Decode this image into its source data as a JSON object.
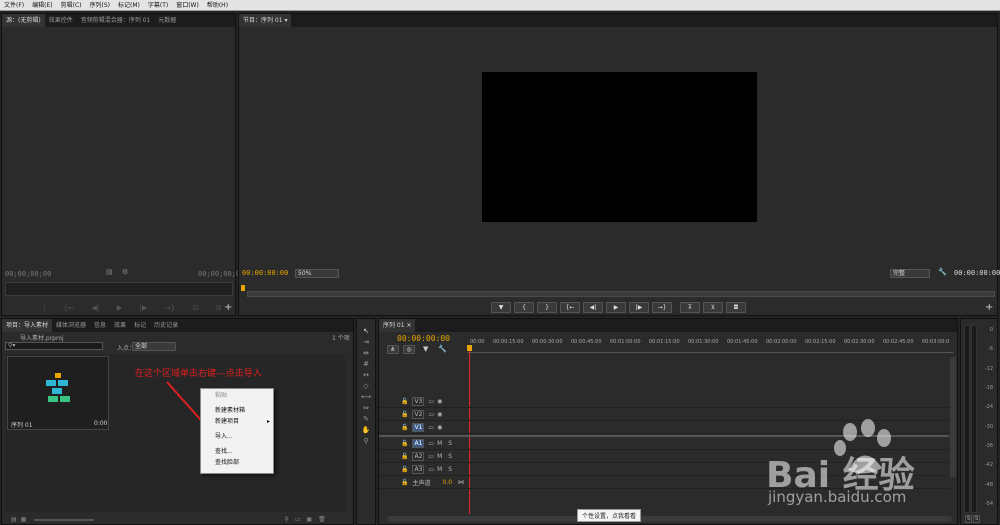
{
  "menu": [
    "文件(F)",
    "编辑(E)",
    "剪辑(C)",
    "序列(S)",
    "标记(M)",
    "字幕(T)",
    "窗口(W)",
    "帮助(H)"
  ],
  "source_panel": {
    "tabs": [
      "源：(无剪辑)",
      "效果控件",
      "音频剪辑混合器：序列 01",
      "元数据"
    ],
    "timecode_left": "00;00;00;00",
    "timecode_right": "00;00;00;00"
  },
  "program_panel": {
    "tab": "节目：序列 01",
    "timecode": "00:00:00:00",
    "zoom": "50%",
    "quality": "完整",
    "timecode_right": "00:00:00:00"
  },
  "project_panel": {
    "tabs": [
      "项目：导入素材",
      "媒体浏览器",
      "信息",
      "效果",
      "标记",
      "历史记录"
    ],
    "project_file": "导入素材.prproj",
    "item_count": "1 个项",
    "inpoint_label": "入点：",
    "inpoint_value": "全部",
    "clip_name": "序列 01",
    "clip_duration": "0:00",
    "annotation": "在这个区域单击右键---点击导入"
  },
  "context_menu": {
    "items": [
      "粘贴",
      "新建素材箱",
      "新建项目",
      "导入...",
      "查找...",
      "查找脸部"
    ]
  },
  "timeline": {
    "tab": "序列 01",
    "timecode": "00:00:00:00",
    "ruler": [
      "00:00",
      "00:00:15:00",
      "00:00:30:00",
      "00:00:45:00",
      "00:01:00:00",
      "00:01:15:00",
      "00:01:30:00",
      "00:01:45:00",
      "00:02:00:00",
      "00:02:15:00",
      "00:02:30:00",
      "00:02:45:00",
      "00:03:00:0"
    ],
    "video_tracks": [
      "V3",
      "V2",
      "V1"
    ],
    "audio_tracks": [
      "A1",
      "A2",
      "A3"
    ],
    "master": "主声道",
    "master_value": "0.0",
    "m_label": "M",
    "s_label": "S"
  },
  "tooltip": "个性设置，点我看看",
  "meter": {
    "ticks": [
      "0",
      "-6",
      "-12",
      "-18",
      "-24",
      "-30",
      "-36",
      "-42",
      "-48",
      "-54"
    ],
    "buttons": [
      "S",
      "S"
    ]
  },
  "watermark": {
    "brand": "Bai 经验",
    "url": "jingyan.baidu.com"
  },
  "colors": {
    "timecode": "#e8a400",
    "playhead": "#e3262a",
    "accent_blue": "#3d7bd8",
    "annotation": "#e02020"
  }
}
